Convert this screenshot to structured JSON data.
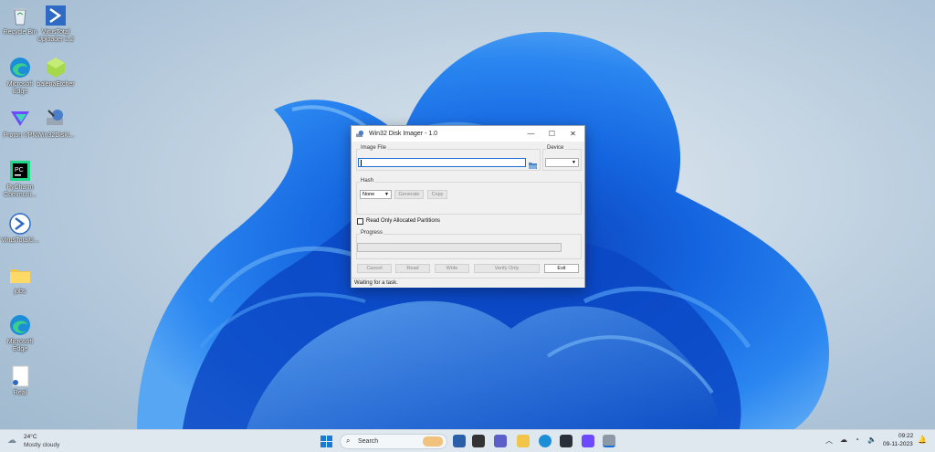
{
  "desktop": {
    "icons": [
      {
        "label": "Recycle Bin",
        "icon": "recycle-bin-icon"
      },
      {
        "label": "VirusTotal Uploader 2.2",
        "icon": "virustotal-icon"
      },
      {
        "label": "Microsoft Edge",
        "icon": "edge-icon"
      },
      {
        "label": "balenaEtcher",
        "icon": "balena-etcher-icon"
      },
      {
        "label": "Proton VPN",
        "icon": "proton-vpn-icon"
      },
      {
        "label": "Win32DiskI...",
        "icon": "win32-disk-imager-icon"
      },
      {
        "label": "PyCharm Communi...",
        "icon": "pycharm-icon"
      },
      {
        "label": "VirusTotalU...",
        "icon": "virustotal-uploader-icon"
      },
      {
        "label": "jobs",
        "icon": "folder-icon"
      },
      {
        "label": "Microsoft Edge",
        "icon": "edge-icon"
      },
      {
        "label": "Real",
        "icon": "file-icon"
      }
    ]
  },
  "window": {
    "title": "Win32 Disk Imager - 1.0",
    "controls": {
      "minimize": "—",
      "maximize": "☐",
      "close": "✕"
    },
    "image_file": {
      "label": "Image File",
      "value": "",
      "browse_icon": "folder-open-icon"
    },
    "device": {
      "label": "Device",
      "value": ""
    },
    "hash": {
      "label": "Hash",
      "selected": "None",
      "generate_label": "Generate",
      "copy_label": "Copy"
    },
    "read_only_partitions": {
      "label": "Read Only Allocated Partitions",
      "checked": false
    },
    "progress": {
      "label": "Progress",
      "value": 0
    },
    "buttons": {
      "cancel": "Cancel",
      "read": "Read",
      "write": "Write",
      "verify": "Verify Only",
      "exit": "Exit"
    },
    "status": "Waiting for a task."
  },
  "taskbar": {
    "weather": {
      "temp": "24°C",
      "condition": "Mostly cloudy"
    },
    "search_placeholder": "Search",
    "clock": {
      "time": "09:22",
      "date": "09-11-2023"
    }
  },
  "colors": {
    "accent": "#1a6ed8",
    "wallpaper_blue": "#0f5fd6",
    "taskbar_bg": "#dfe7ef"
  }
}
